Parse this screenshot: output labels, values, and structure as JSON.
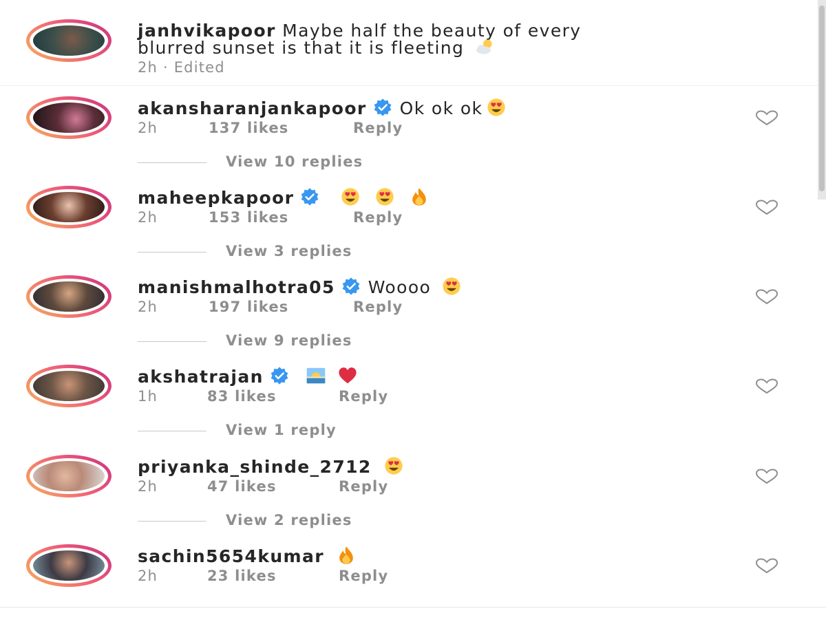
{
  "caption": {
    "username": "janhvikapoor",
    "text_line1": "Maybe half the beauty of every",
    "text_line2": "blurred sunset is that it is fleeting",
    "meta": "2h · Edited"
  },
  "comments": [
    {
      "username": "akansharanjankapoor",
      "verified": true,
      "text": "Ok ok ok",
      "time": "2h",
      "likes": "137 likes",
      "reply": "Reply",
      "view_replies": "View 10 replies"
    },
    {
      "username": "maheepkapoor",
      "verified": true,
      "text": "",
      "time": "2h",
      "likes": "153 likes",
      "reply": "Reply",
      "view_replies": "View 3 replies"
    },
    {
      "username": "manishmalhotra05",
      "verified": true,
      "text": "Woooo",
      "time": "2h",
      "likes": "197 likes",
      "reply": "Reply",
      "view_replies": "View 9 replies"
    },
    {
      "username": "akshatrajan",
      "verified": true,
      "text": "",
      "time": "1h",
      "likes": "83 likes",
      "reply": "Reply",
      "view_replies": "View 1 reply"
    },
    {
      "username": "priyanka_shinde_2712",
      "verified": false,
      "text": "",
      "time": "2h",
      "likes": "47 likes",
      "reply": "Reply",
      "view_replies": "View 2 replies"
    },
    {
      "username": "sachin5654kumar",
      "verified": false,
      "text": "",
      "time": "2h",
      "likes": "23 likes",
      "reply": "Reply"
    }
  ],
  "icons": {
    "like": "heart-outline-icon",
    "verified": "verified-badge-icon",
    "emojis": [
      "sun-behind-cloud-emoji",
      "heart-eyes-emoji",
      "fire-emoji",
      "sunrise-emoji",
      "red-heart-emoji"
    ]
  },
  "colors": {
    "verified_blue": "#3897f0",
    "text": "#262626",
    "secondary_text": "#8e8e8e",
    "story_ring_start": "#f7b15b",
    "story_ring_end": "#c9307f"
  }
}
